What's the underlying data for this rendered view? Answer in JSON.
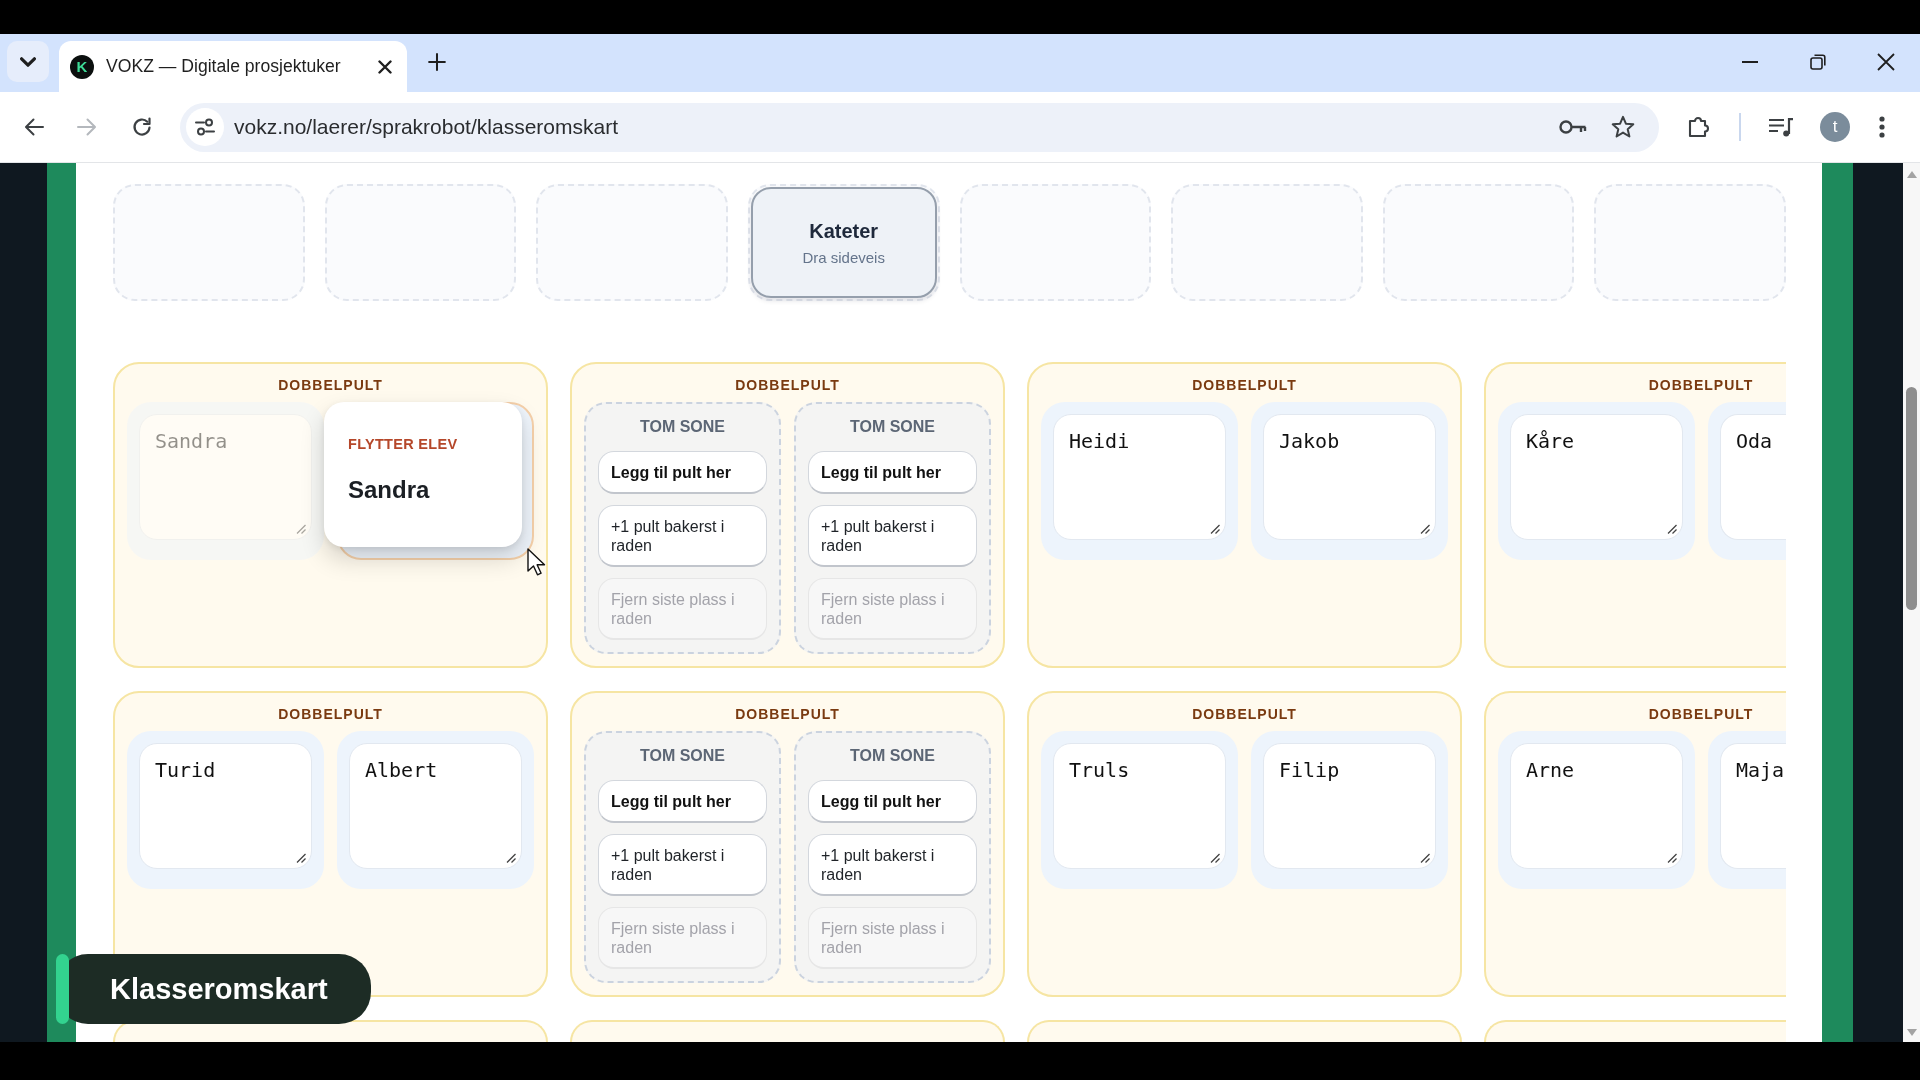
{
  "browser": {
    "tab": {
      "favicon_letter": "K",
      "title": "VOKZ — Digitale prosjektuker",
      "selected": true
    },
    "address": "vokz.no/laerer/sprakrobot/klasseromskart",
    "profile_initial": "t"
  },
  "classroom": {
    "front_row": [
      {
        "kind": "empty"
      },
      {
        "kind": "empty"
      },
      {
        "kind": "empty"
      },
      {
        "kind": "teacher_desk",
        "title": "Kateter",
        "hint": "Dra sideveis"
      },
      {
        "kind": "empty"
      },
      {
        "kind": "empty"
      },
      {
        "kind": "empty"
      },
      {
        "kind": "empty"
      }
    ],
    "desks": [
      {
        "kind": "double",
        "label": "DOBBELPULT",
        "seats": [
          {
            "kind": "student",
            "name": "Sandra",
            "being_moved": true
          },
          {
            "kind": "drop_target",
            "caption": "FLYTTER ELEV",
            "name": "Sandra"
          }
        ]
      },
      {
        "kind": "double",
        "label": "DOBBELPULT",
        "seats": [
          {
            "kind": "empty_zone",
            "title": "TOM SONE",
            "actions": [
              {
                "label": "Legg til pult her",
                "primary": true,
                "disabled": false
              },
              {
                "label": "+1 pult bakerst i raden",
                "primary": false,
                "disabled": false
              },
              {
                "label": "Fjern siste plass i raden",
                "primary": false,
                "disabled": true
              }
            ]
          },
          {
            "kind": "empty_zone",
            "title": "TOM SONE",
            "actions": [
              {
                "label": "Legg til pult her",
                "primary": true,
                "disabled": false
              },
              {
                "label": "+1 pult bakerst i raden",
                "primary": false,
                "disabled": false
              },
              {
                "label": "Fjern siste plass i raden",
                "primary": false,
                "disabled": true
              }
            ]
          }
        ]
      },
      {
        "kind": "double",
        "label": "DOBBELPULT",
        "seats": [
          {
            "kind": "student",
            "name": "Heidi",
            "being_moved": false
          },
          {
            "kind": "student",
            "name": "Jakob",
            "being_moved": false
          }
        ]
      },
      {
        "kind": "double",
        "label": "DOBBELPULT",
        "seats": [
          {
            "kind": "student",
            "name": "Kåre",
            "being_moved": false
          },
          {
            "kind": "student",
            "name": "Oda",
            "being_moved": false
          }
        ]
      },
      {
        "kind": "double",
        "label": "DOBBELPULT",
        "seats": [
          {
            "kind": "student",
            "name": "Turid",
            "being_moved": false
          },
          {
            "kind": "student",
            "name": "Albert",
            "being_moved": false
          }
        ]
      },
      {
        "kind": "double",
        "label": "DOBBELPULT",
        "seats": [
          {
            "kind": "empty_zone",
            "title": "TOM SONE",
            "actions": [
              {
                "label": "Legg til pult her",
                "primary": true,
                "disabled": false
              },
              {
                "label": "+1 pult bakerst i raden",
                "primary": false,
                "disabled": false
              },
              {
                "label": "Fjern siste plass i raden",
                "primary": false,
                "disabled": true
              }
            ]
          },
          {
            "kind": "empty_zone",
            "title": "TOM SONE",
            "actions": [
              {
                "label": "Legg til pult her",
                "primary": true,
                "disabled": false
              },
              {
                "label": "+1 pult bakerst i raden",
                "primary": false,
                "disabled": false
              },
              {
                "label": "Fjern siste plass i raden",
                "primary": false,
                "disabled": true
              }
            ]
          }
        ]
      },
      {
        "kind": "double",
        "label": "DOBBELPULT",
        "seats": [
          {
            "kind": "student",
            "name": "Truls",
            "being_moved": false
          },
          {
            "kind": "student",
            "name": "Filip",
            "being_moved": false
          }
        ]
      },
      {
        "kind": "double",
        "label": "DOBBELPULT",
        "seats": [
          {
            "kind": "student",
            "name": "Arne",
            "being_moved": false
          },
          {
            "kind": "student",
            "name": "Maja",
            "being_moved": false
          }
        ]
      },
      {
        "kind": "double"
      },
      {
        "kind": "double"
      },
      {
        "kind": "double"
      },
      {
        "kind": "double"
      }
    ]
  },
  "section_label": "Klasseromskart"
}
